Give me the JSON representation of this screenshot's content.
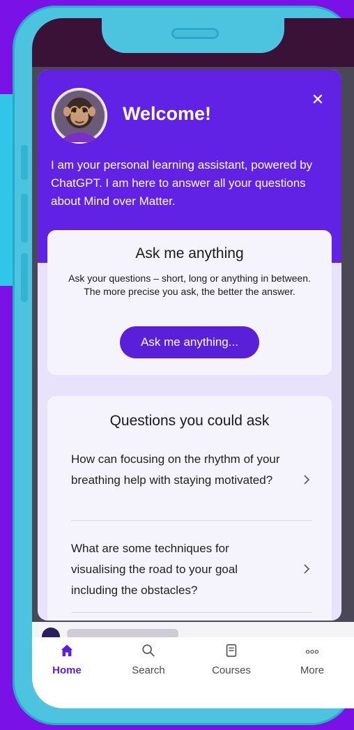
{
  "modal": {
    "title": "Welcome!",
    "intro": "I am your personal learning assistant, powered by ChatGPT. I am here to answer all your questions about Mind over Matter.",
    "close_label": "✕"
  },
  "ask_card": {
    "title": "Ask me anything",
    "description": "Ask your questions – short, long or anything in between. The more precise you ask, the better the answer.",
    "button_label": "Ask me anything..."
  },
  "questions_card": {
    "title": "Questions you could ask",
    "items": [
      {
        "text": "How can focusing on the rhythm of your breathing help with staying motivated?"
      },
      {
        "text": "What are some techniques for visualising the road to your goal including the obstacles?"
      }
    ]
  },
  "nav": {
    "items": [
      {
        "label": "Home",
        "icon": "home-icon",
        "active": true
      },
      {
        "label": "Search",
        "icon": "search-icon",
        "active": false
      },
      {
        "label": "Courses",
        "icon": "book-icon",
        "active": false
      },
      {
        "label": "More",
        "icon": "more-dots-icon",
        "active": false
      }
    ]
  },
  "colors": {
    "background": "#7a12e8",
    "phone": "#4cc3df",
    "modal_header": "#6222e6",
    "accent": "#5a1fd8"
  }
}
